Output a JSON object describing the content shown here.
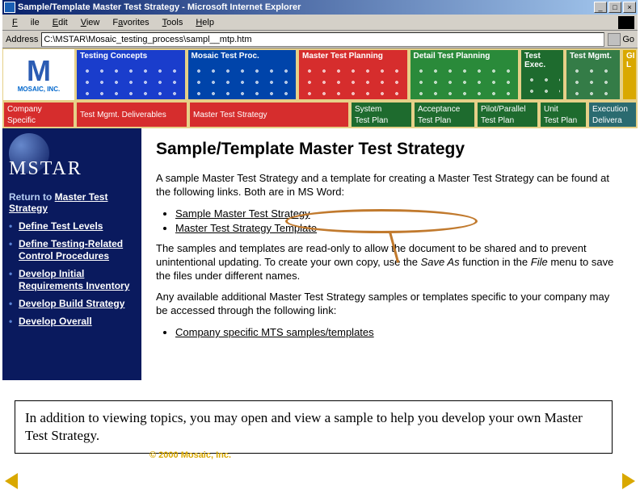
{
  "window": {
    "title": "Sample/Template Master Test Strategy - Microsoft Internet Explorer",
    "min": "_",
    "max": "□",
    "close": "×"
  },
  "menu": {
    "file": "File",
    "edit": "Edit",
    "view": "View",
    "favorites": "Favorites",
    "tools": "Tools",
    "help": "Help"
  },
  "address": {
    "label": "Address",
    "value": "C:\\MSTAR\\Mosaic_testing_process\\sampl__mtp.htm",
    "go": "Go"
  },
  "navrow1": {
    "logo_text": "MOSAIC, INC.",
    "items": [
      {
        "label": "Testing Concepts"
      },
      {
        "label": "Mosaic Test Proc."
      },
      {
        "label": "Master Test Planning"
      },
      {
        "label": "Detail Test Planning"
      },
      {
        "label": "Test Exec."
      },
      {
        "label": "Test Mgmt."
      },
      {
        "label": "GI L"
      }
    ]
  },
  "navrow2": {
    "items": [
      {
        "l1": "Company",
        "l2": "Specific"
      },
      {
        "l1": "Test Mgmt. Deliverables",
        "l2": ""
      },
      {
        "l1": "Master Test Strategy",
        "l2": ""
      },
      {
        "l1": "System",
        "l2": "Test Plan"
      },
      {
        "l1": "Acceptance",
        "l2": "Test Plan"
      },
      {
        "l1": "Pilot/Parallel",
        "l2": "Test Plan"
      },
      {
        "l1": "Unit",
        "l2": "Test Plan"
      },
      {
        "l1": "Execution",
        "l2": "Delivera"
      }
    ]
  },
  "sidebar": {
    "brand": "MSTAR",
    "return_prefix": "Return to ",
    "return_link": "Master Test Strategy",
    "links": [
      "Define Test Levels",
      "Define Testing-Related Control Procedures",
      "Develop Initial Requirements Inventory",
      "Develop Build Strategy",
      "Develop Overall"
    ]
  },
  "content": {
    "title": "Sample/Template Master Test Strategy",
    "p1": "A sample Master Test Strategy and a template for creating a Master Test Strategy can be found at the following links.  Both are in MS Word:",
    "link1": "Sample Master Test Strategy",
    "link2": "Master Test Strategy Template",
    "p2a": "The samples and templates are read-only to allow the document to be shared and to prevent unintentional updating.  To create your own copy, use the ",
    "p2b": "Save As",
    "p2c": " function in the ",
    "p2d": "File",
    "p2e": " menu to save the files under different names.",
    "p3": "Any available additional Master Test Strategy samples or templates specific to your company may be accessed through the following link:",
    "link3": "Company specific MTS samples/templates"
  },
  "caption": "In addition to viewing topics, you may open and view a sample to help you develop your own Master Test Strategy.",
  "copyright": "© 2000 Mosaic, Inc."
}
